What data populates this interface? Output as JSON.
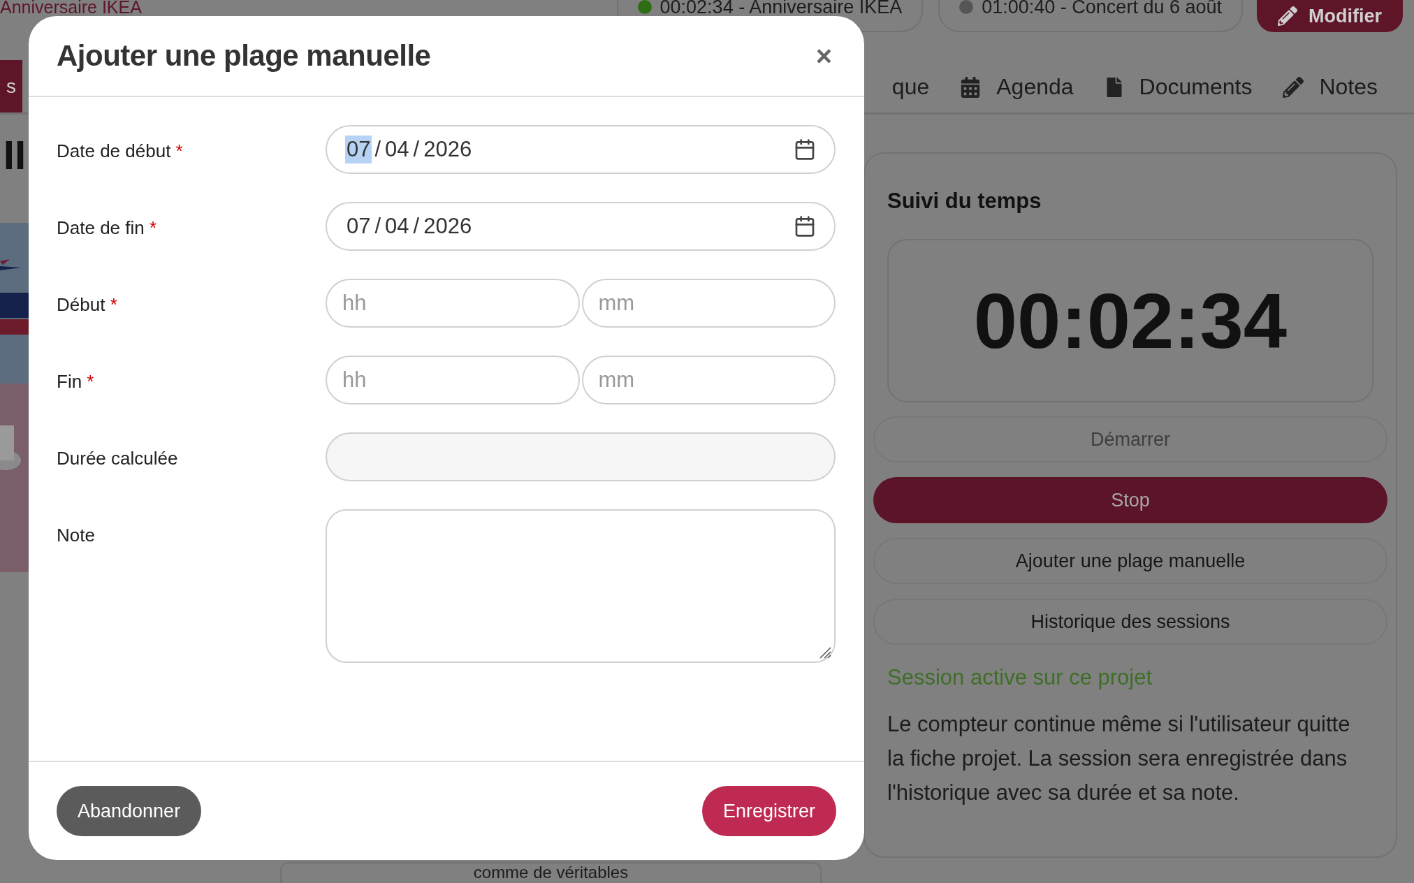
{
  "header": {
    "project_title": "Anniversaire IKEA",
    "timers": [
      {
        "label": "00:02:34 - Anniversaire IKEA",
        "color": "#2f6e14"
      },
      {
        "label": "01:00:40 - Concert du 6 août",
        "color": "#555555"
      }
    ],
    "edit_button": "Modifier"
  },
  "side_tab": "s",
  "tabs": [
    {
      "label": "que",
      "kind": "plain"
    },
    {
      "label": "Agenda",
      "kind": "calendar"
    },
    {
      "label": "Documents",
      "kind": "file"
    },
    {
      "label": "Notes",
      "kind": "pencil"
    }
  ],
  "page_heading": "II",
  "bottom_card_text": "comme de véritables",
  "time_tracking": {
    "title": "Suivi du temps",
    "timer": "00:02:34",
    "buttons": [
      {
        "label": "Démarrer",
        "kind": "outline",
        "disabled": true
      },
      {
        "label": "Stop",
        "kind": "primary",
        "disabled": false
      },
      {
        "label": "Ajouter une plage manuelle",
        "kind": "outline",
        "disabled": false
      },
      {
        "label": "Historique des sessions",
        "kind": "outline",
        "disabled": false
      }
    ],
    "status": "Session active sur ce projet",
    "description": "Le compteur continue même si l'utilisateur quitte la fiche projet. La session sera enregistrée dans l'historique avec sa durée et sa note."
  },
  "modal": {
    "title": "Ajouter une plage manuelle",
    "close": "×",
    "required_mark": "*",
    "fields": [
      {
        "label": "Date de début",
        "required": true,
        "kind": "date",
        "separator": "/",
        "segments": [
          {
            "text": "07",
            "selected": true
          },
          {
            "text": "04",
            "selected": false
          },
          {
            "text": "2026",
            "selected": false
          }
        ]
      },
      {
        "label": "Date de fin",
        "required": true,
        "kind": "date",
        "separator": "/",
        "segments": [
          {
            "text": "07",
            "selected": false
          },
          {
            "text": "04",
            "selected": false
          },
          {
            "text": "2026",
            "selected": false
          }
        ]
      },
      {
        "label": "Début",
        "required": true,
        "kind": "time",
        "placeholders": [
          "hh",
          "mm"
        ]
      },
      {
        "label": "Fin",
        "required": true,
        "kind": "time",
        "placeholders": [
          "hh",
          "mm"
        ]
      },
      {
        "label": "Durée calculée",
        "required": false,
        "kind": "readonly"
      },
      {
        "label": "Note",
        "required": false,
        "kind": "textarea"
      }
    ],
    "cancel": "Abandonner",
    "save": "Enregistrer"
  }
}
